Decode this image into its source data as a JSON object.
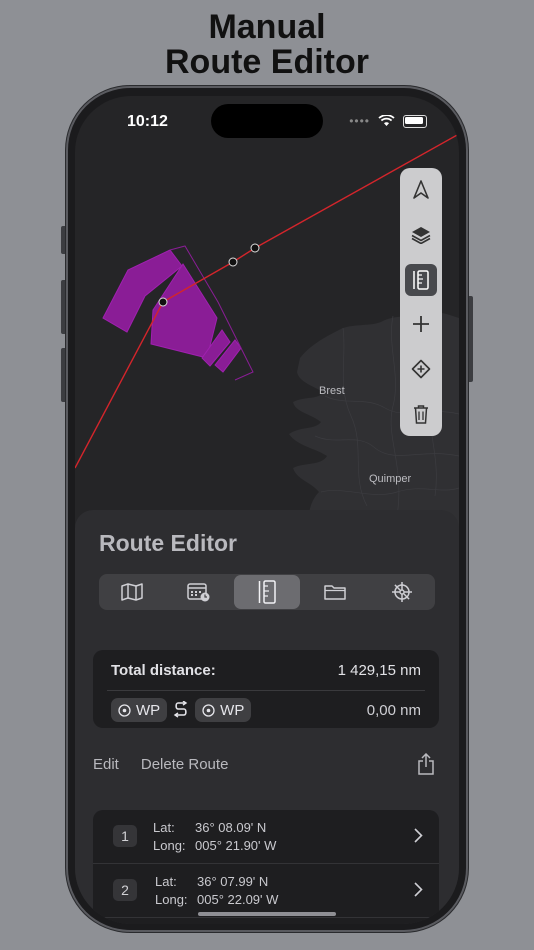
{
  "headline": {
    "line1": "Manual",
    "line2": "Route Editor"
  },
  "status": {
    "time": "10:12"
  },
  "map": {
    "labels": {
      "brest": "Brest",
      "quimper": "Quimper"
    }
  },
  "toolbar": {
    "tools": [
      {
        "icon": "navigation-arrow-icon"
      },
      {
        "icon": "layers-icon"
      },
      {
        "icon": "ruler-icon",
        "active": true
      },
      {
        "icon": "plus-icon"
      },
      {
        "icon": "add-waypoint-icon"
      },
      {
        "icon": "trash-icon"
      }
    ]
  },
  "panel": {
    "title": "Route Editor",
    "tabs": [
      {
        "icon": "map-icon"
      },
      {
        "icon": "calendar-icon"
      },
      {
        "icon": "ruler-icon",
        "active": true
      },
      {
        "icon": "folder-icon"
      },
      {
        "icon": "helm-icon"
      }
    ],
    "distance": {
      "label": "Total distance:",
      "value": "1 429,15 nm",
      "from": "WP",
      "to": "WP",
      "segment_value": "0,00 nm"
    },
    "actions": {
      "edit": "Edit",
      "delete": "Delete Route"
    },
    "waypoints": [
      {
        "num": "1",
        "lat_label": "Lat:",
        "lat": "36° 08.09' N",
        "long_label": "Long:",
        "long": "005° 21.90' W"
      },
      {
        "num": "2",
        "lat_label": "Lat:",
        "lat": "36° 07.99' N",
        "long_label": "Long:",
        "long": "005° 22.09' W"
      }
    ]
  },
  "colors": {
    "route": "#d3252b",
    "zone": "#8a1d96",
    "toolbar_bg": "#ccccce",
    "panel_bg": "#2d2d30"
  }
}
